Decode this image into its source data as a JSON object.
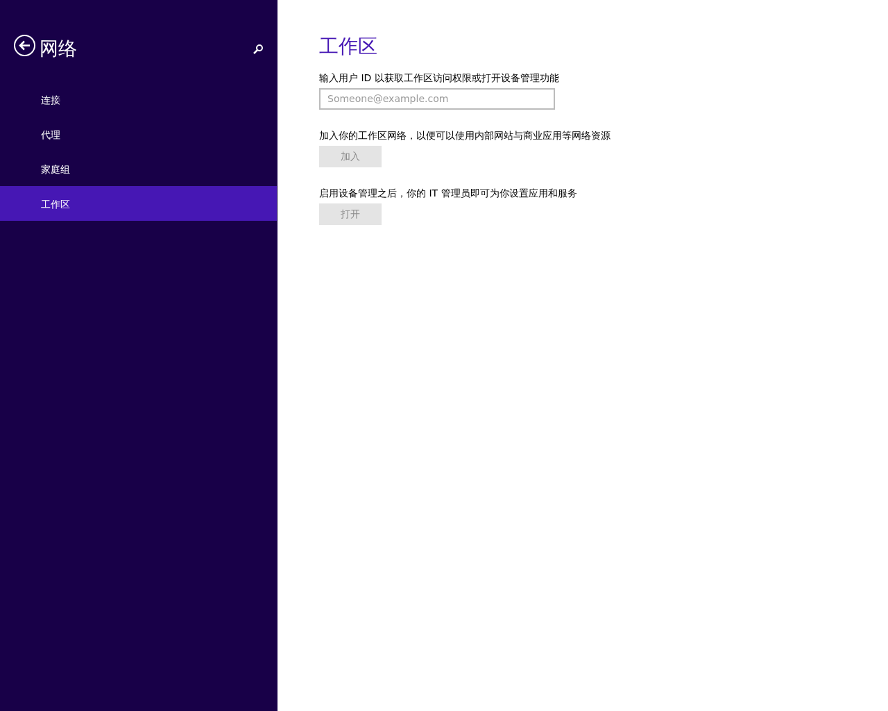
{
  "sidebar": {
    "title": "网络",
    "items": [
      {
        "label": "连接",
        "selected": false
      },
      {
        "label": "代理",
        "selected": false
      },
      {
        "label": "家庭组",
        "selected": false
      },
      {
        "label": "工作区",
        "selected": true
      }
    ]
  },
  "content": {
    "title": "工作区",
    "sections": [
      {
        "kind": "field",
        "description": "输入用户 ID 以获取工作区访问权限或打开设备管理功能",
        "placeholder": "Someone@example.com"
      },
      {
        "kind": "button",
        "description": "加入你的工作区网络，以便可以使用内部网站与商业应用等网络资源",
        "button": "加入",
        "disabled": true
      },
      {
        "kind": "button",
        "description": "启用设备管理之后，你的 IT 管理员即可为你设置应用和服务",
        "button": "打开",
        "disabled": true
      }
    ]
  }
}
